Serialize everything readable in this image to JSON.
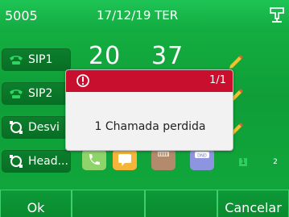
{
  "status_bar": {
    "account": "5005",
    "datetime": "17/12/19 TER",
    "network_icon": "network-icon"
  },
  "line_keys": [
    {
      "label": "SIP1",
      "icon": "phone-icon"
    },
    {
      "label": "SIP2",
      "icon": "phone-icon"
    },
    {
      "label": "Desvi",
      "icon": "dnd-circle-icon"
    },
    {
      "label": "Head...",
      "icon": "dnd-circle-icon"
    }
  ],
  "clock": {
    "hours": "20",
    "minutes": "37"
  },
  "dialog": {
    "count": "1/1",
    "message": "1 Chamada perdida",
    "icon": "alert-icon"
  },
  "app_tiles": [
    {
      "name": "phone-app-icon",
      "color": "#8fd36b"
    },
    {
      "name": "messages-app-icon",
      "color": "#f5b53a"
    },
    {
      "name": "directory-app-icon",
      "color": "#b38a6b"
    },
    {
      "name": "dnd-app-icon",
      "color": "#8e95e0"
    }
  ],
  "page_indicators": [
    "1",
    "2"
  ],
  "softkeys": {
    "ok": "Ok",
    "blank1": "",
    "blank2": "",
    "cancel": "Cancelar"
  },
  "colors": {
    "background": "#11aa3c",
    "dialog_header": "#c8102e",
    "line_key": "#0b7f2c"
  }
}
